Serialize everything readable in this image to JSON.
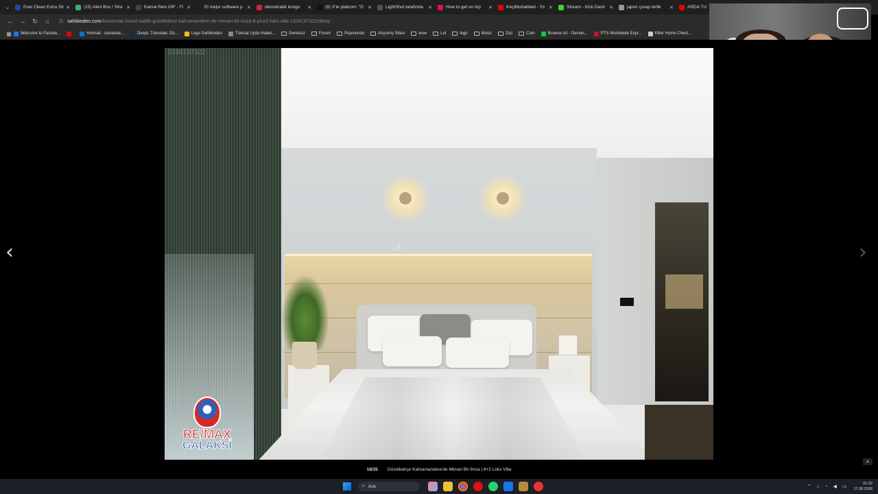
{
  "tabs": [
    {
      "label": "Ever Clean Extra Str",
      "color": "#1d4ba8"
    },
    {
      "label": "(15) Alert Box / Stre",
      "color": "#3cb371"
    },
    {
      "label": "Kamal Reis GIF - Fi",
      "color": "#444"
    },
    {
      "label": "El mejor software p",
      "color": "#222"
    },
    {
      "label": "demokratik kongo",
      "color": "#cc2244"
    },
    {
      "label": "(8) X'te platcom: \"D",
      "color": "#111"
    },
    {
      "label": "LightShot tarafında",
      "color": "#445566"
    },
    {
      "label": "How to get on top",
      "color": "#e0114a"
    },
    {
      "label": "KeçiMuhabbeti - Yo",
      "color": "#e00"
    },
    {
      "label": "Stream - Kick Dash",
      "color": "#3cd33c"
    },
    {
      "label": "japon çorap terlik",
      "color": "#999"
    },
    {
      "label": "ARDA TU",
      "color": "#e00"
    }
  ],
  "url": {
    "host": "sahibinden.com",
    "path": "/ilan/emlak-konut-satilik-guzelbahce-kahramandere-de-mimari-bir-imza-8-plus2-luks-villa-1334197322/detay"
  },
  "bookmarks": [
    {
      "label": "Welcome to Facebo...",
      "color": "#1877f2",
      "type": "site"
    },
    {
      "label": "",
      "color": "#e00",
      "type": "site"
    },
    {
      "label": "Hotmail - cavlantat...",
      "color": "#0078d4",
      "type": "site"
    },
    {
      "label": "DeepL Translate: Dü...",
      "color": "#0f2b46",
      "type": "site"
    },
    {
      "label": "Lego Sahibinden",
      "color": "#f6c200",
      "type": "site"
    },
    {
      "label": "Türksat Uydu Haber...",
      "color": "#888",
      "type": "site"
    },
    {
      "label": "Gereksiz",
      "type": "folder"
    },
    {
      "label": "Forum",
      "type": "folder"
    },
    {
      "label": "Popmundo",
      "type": "folder"
    },
    {
      "label": "Alışveriş Sitesi",
      "type": "folder"
    },
    {
      "label": "wow",
      "type": "folder"
    },
    {
      "label": "Lol",
      "type": "folder"
    },
    {
      "label": "lego",
      "type": "folder"
    },
    {
      "label": "Music",
      "type": "folder"
    },
    {
      "label": "Dizi",
      "type": "folder"
    },
    {
      "label": "Coin",
      "type": "folder"
    },
    {
      "label": "Browse Art - Devian...",
      "color": "#05cc47",
      "type": "site"
    },
    {
      "label": "PTS Worldwide Expr...",
      "color": "#c8102e",
      "type": "site"
    },
    {
      "label": "Killer Home Chest...",
      "color": "#ccc",
      "type": "site"
    }
  ],
  "gallery": {
    "listing_id": "1334197322",
    "logo_brand": "RE/MAX",
    "logo_sub": "GALAKSİ",
    "counter": "18/35",
    "title": "Güzelbahçe Kahramandere'de Mimari Bir İmza | 8+2 Lüks Villa"
  },
  "taskbar": {
    "search_label": "Ara",
    "time": "01:32",
    "date": "17.08.2026"
  }
}
